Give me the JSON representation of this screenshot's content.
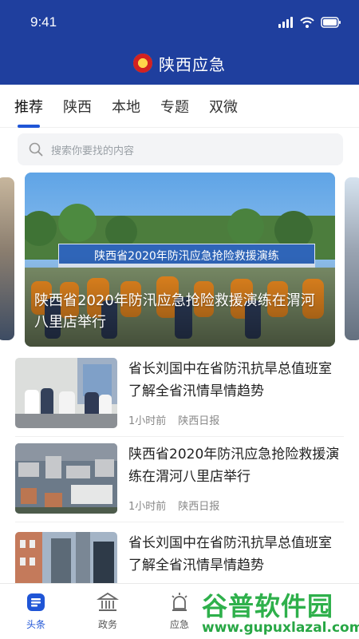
{
  "status_bar": {
    "time": "9:41"
  },
  "header": {
    "title": "陕西应急"
  },
  "tabs": [
    {
      "label": "推荐",
      "active": true
    },
    {
      "label": "陕西",
      "active": false
    },
    {
      "label": "本地",
      "active": false
    },
    {
      "label": "专题",
      "active": false
    },
    {
      "label": "双微",
      "active": false
    }
  ],
  "search": {
    "placeholder": "搜索你要找的内容",
    "icon": "search-icon"
  },
  "banner": {
    "caption": "陕西省2020年防汛应急抢险救援演练在渭河八里店举行",
    "stage_sign": "陕西省2020年防汛应急抢险救援演练"
  },
  "news": [
    {
      "title": "省长刘国中在省防汛抗旱总值班室了解全省汛情旱情趋势",
      "time": "1小时前",
      "source": "陕西日报"
    },
    {
      "title": "陕西省2020年防汛应急抢险救援演练在渭河八里店举行",
      "time": "1小时前",
      "source": "陕西日报"
    },
    {
      "title": "省长刘国中在省防汛抗旱总值班室了解全省汛情旱情趋势",
      "time": "",
      "source": ""
    }
  ],
  "bottom_nav": [
    {
      "label": "头条",
      "icon": "headline-icon",
      "active": true
    },
    {
      "label": "政务",
      "icon": "government-icon",
      "active": false
    },
    {
      "label": "应急",
      "icon": "emergency-alarm-icon",
      "active": false
    }
  ],
  "watermark": {
    "line1": "谷普软件园",
    "line2": "www.gupuxlazal.com"
  },
  "colors": {
    "primary": "#1f3f9e",
    "accent": "#1f55d6",
    "watermark_green": "#2eb04b"
  }
}
